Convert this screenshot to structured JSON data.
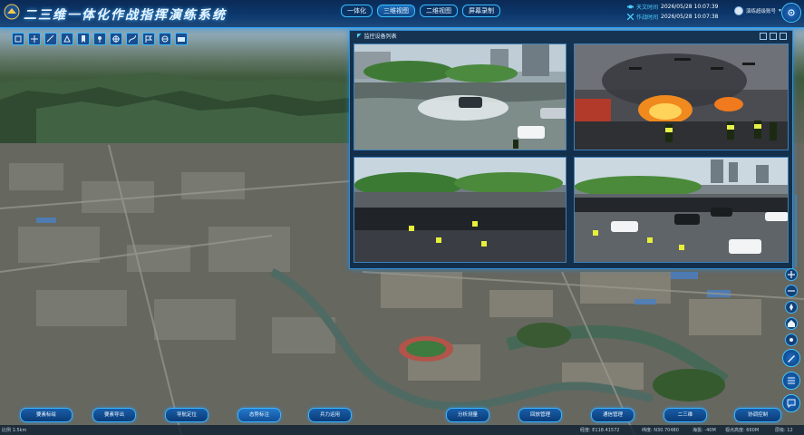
{
  "header": {
    "title": "二三维一体化作战指挥演练系统",
    "view_tabs": [
      "一体化",
      "三维视图",
      "二维视图",
      "屏幕录制"
    ],
    "active_tab": 1,
    "real_time_label": "天文时间",
    "real_time": "2026/05/28 10:07:39",
    "sim_time_label": "作战时间",
    "sim_time": "2026/05/28 10:07:38",
    "user_name": "演练超级账号"
  },
  "video_panel": {
    "title": "监控设备列表",
    "cams": [
      "flooded-street-car",
      "drone-fire-scene",
      "crowd-gathering-police",
      "crowd-police-vehicles"
    ]
  },
  "toolbar": {
    "bottom_buttons": [
      "要素标绘",
      "要素导出",
      "导航定位",
      "态势标注",
      "兵力运用",
      "分析测量",
      "回放管理",
      "通信管理",
      "二三维",
      "协调控制"
    ],
    "active_bottom": 3
  },
  "status": {
    "left": "比例 1:5km",
    "lon": "经度: E118.41572",
    "lat": "纬度: N30.70480",
    "alt": "海拔: -40M",
    "view_height": "视点高度: 660M",
    "level": "层级: 12"
  },
  "colors": {
    "accent": "#2aa6ff",
    "header": "#0d3a70",
    "panel": "#0c2a4a"
  }
}
